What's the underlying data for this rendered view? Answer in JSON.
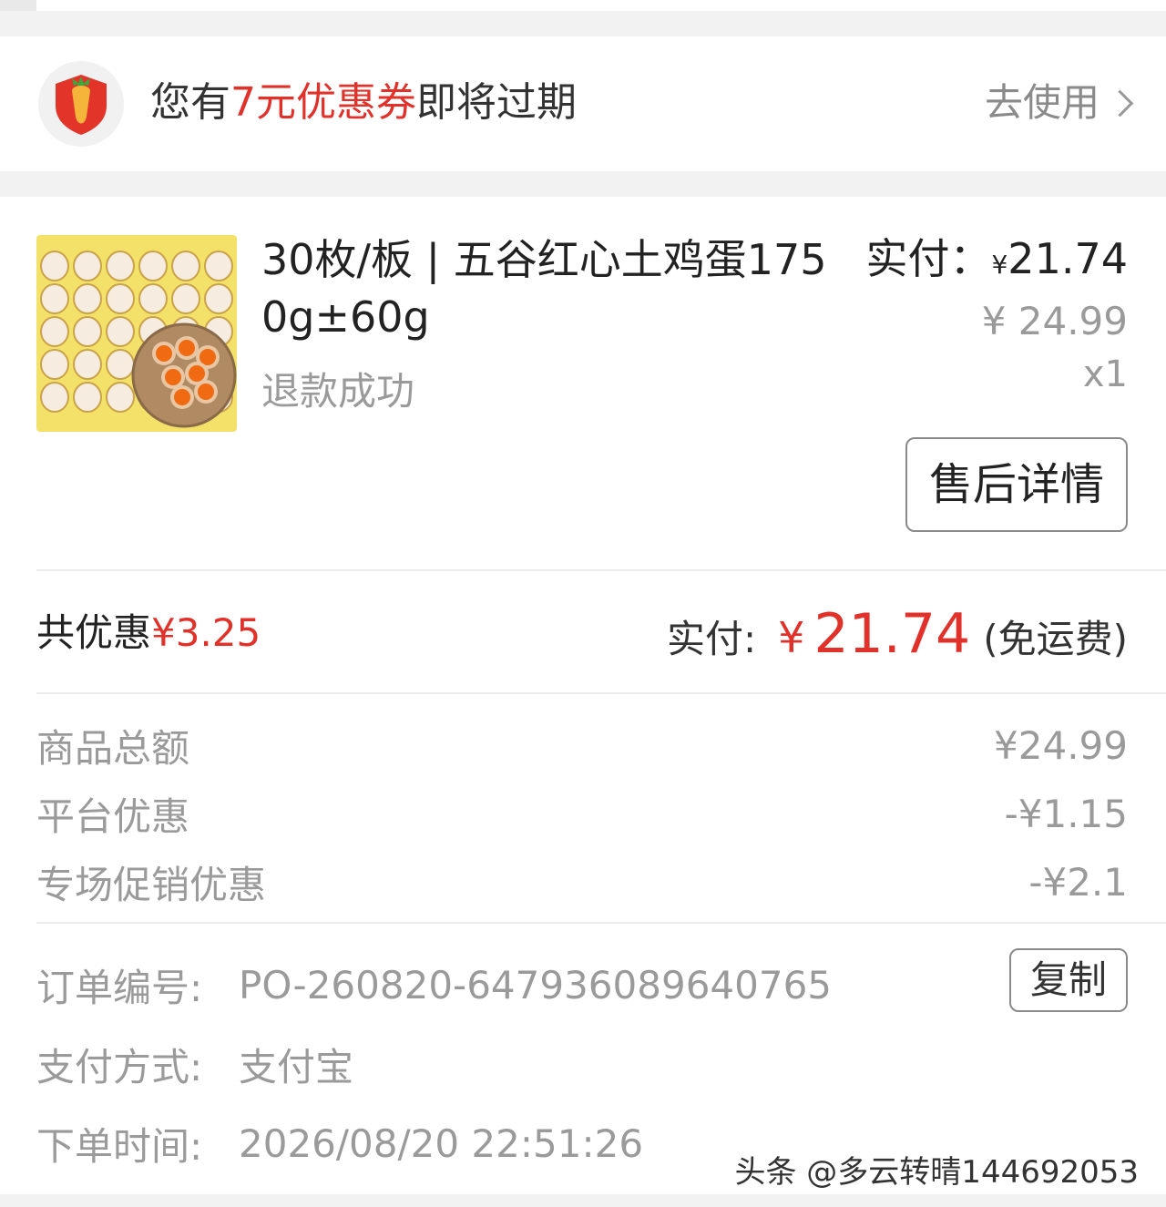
{
  "coupon": {
    "text_before": "您有",
    "text_highlight": "7元优惠券",
    "text_after": "即将过期",
    "action_label": "去使用"
  },
  "order_item": {
    "title": "30枚/板 | 五谷红心土鸡蛋1750g±60g",
    "status": "退款成功",
    "paid_label": "实付：",
    "paid_currency": "¥",
    "paid_amount": "21.74",
    "original_price": "¥ 24.99",
    "quantity": "x1",
    "after_sale_button": "售后详情"
  },
  "summary": {
    "discount_label": "共优惠",
    "discount_amount": "¥3.25",
    "paid_label": "实付:",
    "paid_currency": "¥",
    "paid_amount": "21.74",
    "shipping_note": "(免运费)"
  },
  "fees": [
    {
      "label": "商品总额",
      "value": "¥24.99"
    },
    {
      "label": "平台优惠",
      "value": "-¥1.15"
    },
    {
      "label": "专场促销优惠",
      "value": "-¥2.1"
    }
  ],
  "order_info": {
    "order_no_label": "订单编号:",
    "order_no": "PO-260820-647936089640765",
    "copy_button": "复制",
    "payment_label": "支付方式:",
    "payment": "支付宝",
    "time_label": "下单时间:",
    "time": "2026/08/20 22:51:26"
  },
  "watermark": "头条 @多云转晴144692053",
  "colors": {
    "accent_red": "#e0322a",
    "muted_text": "#9a9a9a",
    "background": "#f2f2f2"
  },
  "icons": {
    "coupon_logo": "carrot-shield-icon",
    "action_arrow": "chevron-right-icon"
  }
}
